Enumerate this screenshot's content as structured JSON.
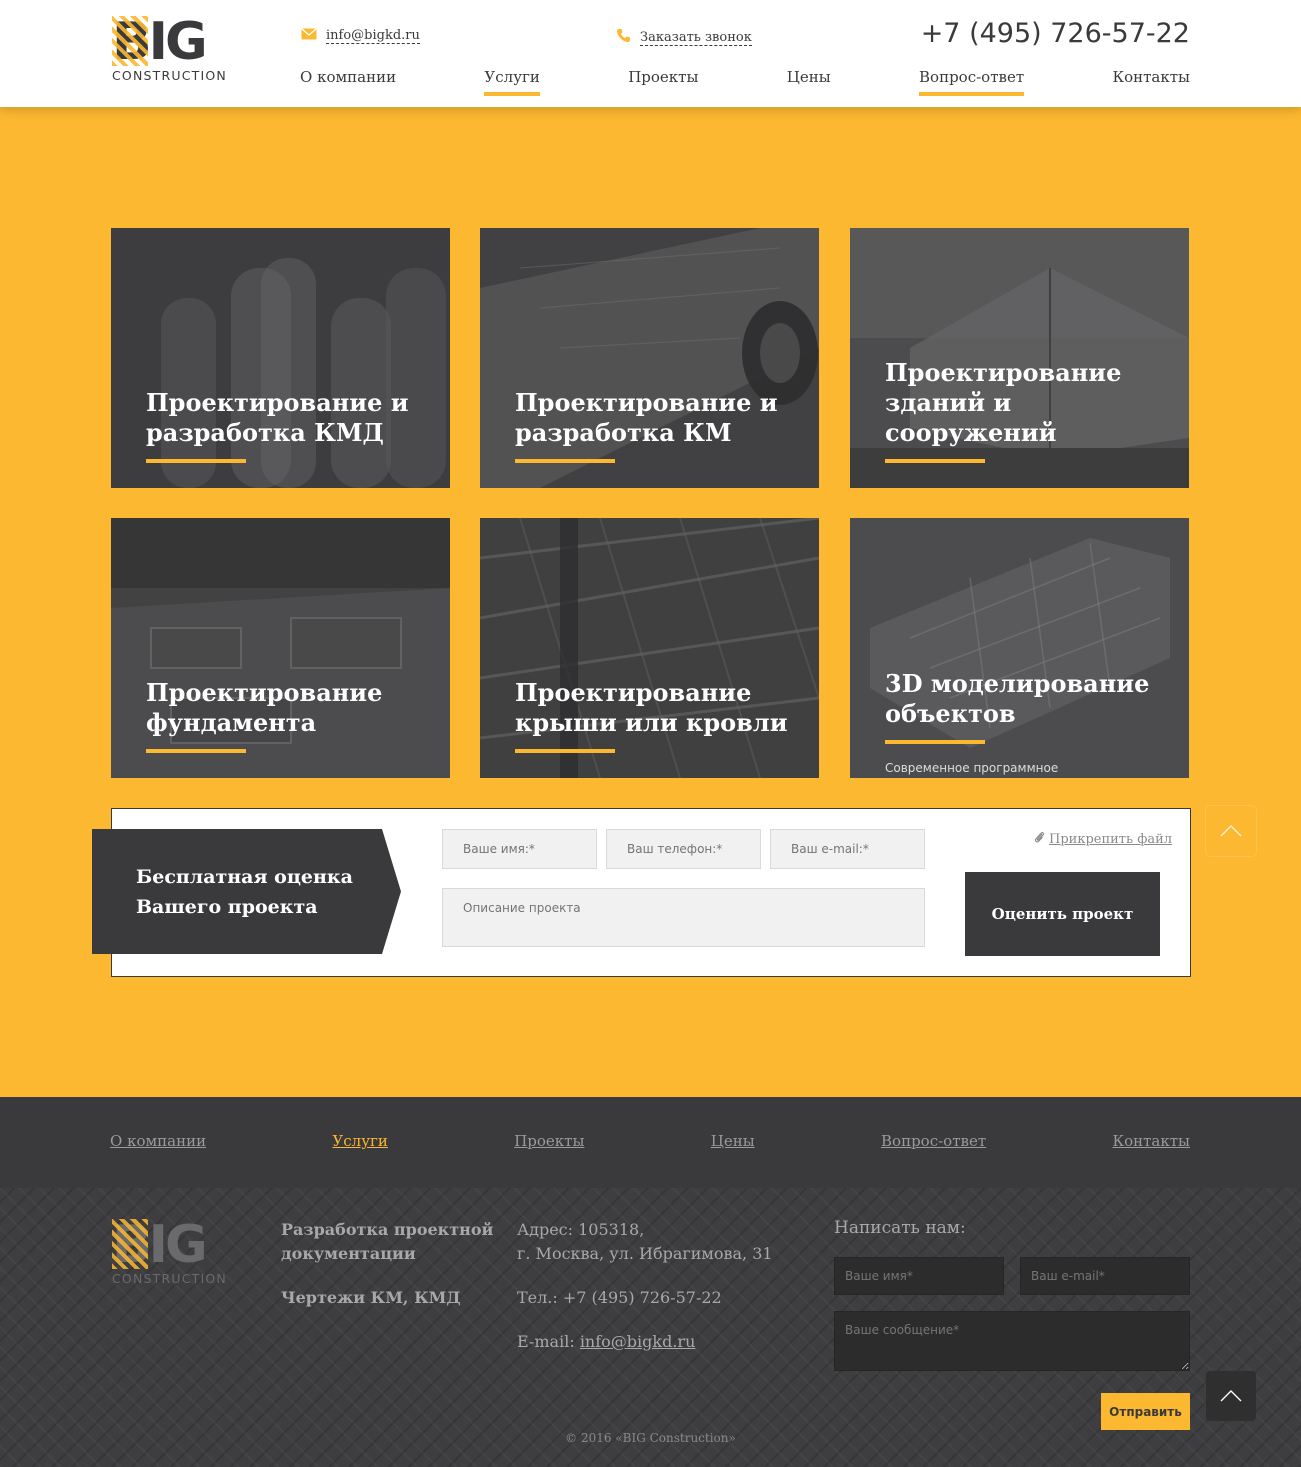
{
  "logo": {
    "main": "BIG",
    "sub": "CONSTRUCTION"
  },
  "header": {
    "email": "info@bigkd.ru",
    "callback": "Заказать звонок",
    "phone": "+7 (495) 726-57-22"
  },
  "nav": [
    {
      "label": "О компании",
      "active": false
    },
    {
      "label": "Услуги",
      "active": true
    },
    {
      "label": "Проекты",
      "active": false
    },
    {
      "label": "Цены",
      "active": false
    },
    {
      "label": "Вопрос-ответ",
      "active": true
    },
    {
      "label": "Контакты",
      "active": false
    }
  ],
  "services": [
    {
      "title": "Проектирование и разработка КМД"
    },
    {
      "title": "Проектирование и разработка КМ"
    },
    {
      "title": "Проектирование зданий и сооружений"
    },
    {
      "title": "Проектирование фундамента"
    },
    {
      "title": "Проектирование крыши или кровли"
    },
    {
      "title": "3D моделирование объектов",
      "subtitle": "Современное программное"
    }
  ],
  "estimate": {
    "label_line1": "Бесплатная оценка",
    "label_line2": "Вашего проекта",
    "name_placeholder": "Ваше имя:*",
    "phone_placeholder": "Ваш телефон:*",
    "email_placeholder": "Ваш e-mail:*",
    "description_placeholder": "Описание проекта",
    "attach": "Прикрепить файл",
    "submit": "Оценить проект"
  },
  "footer_nav": [
    {
      "label": "О компании",
      "active": false
    },
    {
      "label": "Услуги",
      "active": true
    },
    {
      "label": "Проекты",
      "active": false
    },
    {
      "label": "Цены",
      "active": false
    },
    {
      "label": "Вопрос-ответ",
      "active": false
    },
    {
      "label": "Контакты",
      "active": false
    }
  ],
  "footer": {
    "tagline_line1": "Разработка проектной",
    "tagline_line2": "документации",
    "specialty": "Чертежи КМ, КМД",
    "address_line1": "Адрес: 105318,",
    "address_line2": "г. Москва, ул. Ибрагимова, 31",
    "phone": "Тел.: +7 (495) 726-57-22",
    "email_label": "E-mail: ",
    "email": "info@bigkd.ru",
    "write_us": "Написать нам:",
    "name_placeholder": "Ваше имя*",
    "email_placeholder": "Ваш e-mail*",
    "message_placeholder": "Ваше сообщение*",
    "send": "Отправить",
    "copyright": "© 2016 «BIG Construction»"
  },
  "colors": {
    "accent": "#fbb830",
    "dark": "#3a3a3c",
    "white": "#ffffff"
  }
}
